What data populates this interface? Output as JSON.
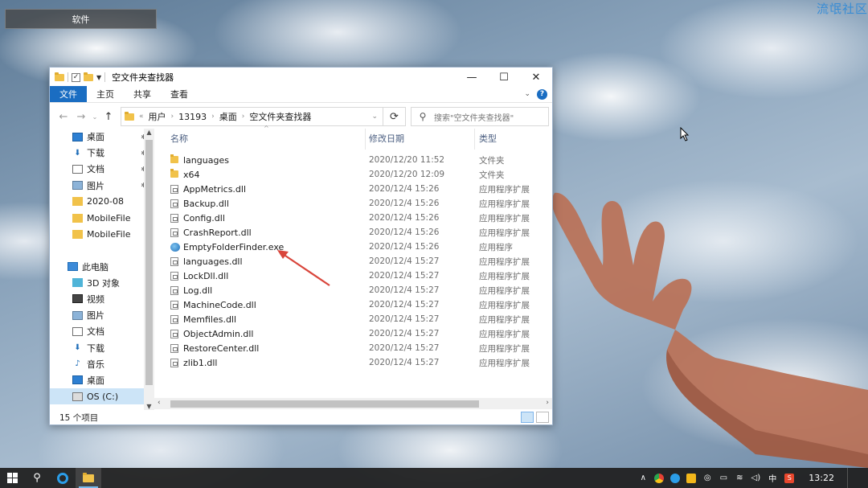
{
  "desktop": {
    "software_label": "软件",
    "watermark": "流氓社区"
  },
  "window": {
    "title": "空文件夹查找器",
    "controls": {
      "minimize": "—",
      "maximize": "☐",
      "close": "✕"
    },
    "ribbon_tabs": [
      "文件",
      "主页",
      "共享",
      "查看"
    ],
    "breadcrumb": [
      "用户",
      "13193",
      "桌面",
      "空文件夹查找器"
    ],
    "search_placeholder": "搜索\"空文件夹查找器\"",
    "columns": {
      "name": "名称",
      "date": "修改日期",
      "type": "类型"
    },
    "nav_items": [
      {
        "label": "桌面",
        "icon": "desktop-icon",
        "pinned": true
      },
      {
        "label": "下载",
        "icon": "download-icon",
        "pinned": true
      },
      {
        "label": "文档",
        "icon": "document-icon",
        "pinned": true
      },
      {
        "label": "图片",
        "icon": "picture-icon",
        "pinned": true
      },
      {
        "label": "2020-08",
        "icon": "folder-icon",
        "pinned": false
      },
      {
        "label": "MobileFile",
        "icon": "folder-icon",
        "pinned": false
      },
      {
        "label": "MobileFile",
        "icon": "folder-icon",
        "pinned": false
      },
      {
        "label": "",
        "icon": "",
        "pinned": false
      },
      {
        "label": "此电脑",
        "icon": "computer-icon",
        "pinned": false
      },
      {
        "label": "3D 对象",
        "icon": "3d-objects-icon",
        "pinned": false
      },
      {
        "label": "视频",
        "icon": "video-icon",
        "pinned": false
      },
      {
        "label": "图片",
        "icon": "picture-icon",
        "pinned": false
      },
      {
        "label": "文档",
        "icon": "document-icon",
        "pinned": false
      },
      {
        "label": "下载",
        "icon": "download-icon",
        "pinned": false
      },
      {
        "label": "音乐",
        "icon": "music-icon",
        "pinned": false
      },
      {
        "label": "桌面",
        "icon": "desktop-icon",
        "pinned": false
      },
      {
        "label": "OS (C:)",
        "icon": "drive-icon",
        "pinned": false
      }
    ],
    "files": [
      {
        "name": "languages",
        "date": "2020/12/20 11:52",
        "type": "文件夹",
        "icon": "folder"
      },
      {
        "name": "x64",
        "date": "2020/12/20 12:09",
        "type": "文件夹",
        "icon": "folder"
      },
      {
        "name": "AppMetrics.dll",
        "date": "2020/12/4 15:26",
        "type": "应用程序扩展",
        "icon": "dll"
      },
      {
        "name": "Backup.dll",
        "date": "2020/12/4 15:26",
        "type": "应用程序扩展",
        "icon": "dll"
      },
      {
        "name": "Config.dll",
        "date": "2020/12/4 15:26",
        "type": "应用程序扩展",
        "icon": "dll"
      },
      {
        "name": "CrashReport.dll",
        "date": "2020/12/4 15:26",
        "type": "应用程序扩展",
        "icon": "dll"
      },
      {
        "name": "EmptyFolderFinder.exe",
        "date": "2020/12/4 15:26",
        "type": "应用程序",
        "icon": "exe"
      },
      {
        "name": "languages.dll",
        "date": "2020/12/4 15:27",
        "type": "应用程序扩展",
        "icon": "dll"
      },
      {
        "name": "LockDll.dll",
        "date": "2020/12/4 15:27",
        "type": "应用程序扩展",
        "icon": "dll"
      },
      {
        "name": "Log.dll",
        "date": "2020/12/4 15:27",
        "type": "应用程序扩展",
        "icon": "dll"
      },
      {
        "name": "MachineCode.dll",
        "date": "2020/12/4 15:27",
        "type": "应用程序扩展",
        "icon": "dll"
      },
      {
        "name": "Memfiles.dll",
        "date": "2020/12/4 15:27",
        "type": "应用程序扩展",
        "icon": "dll"
      },
      {
        "name": "ObjectAdmin.dll",
        "date": "2020/12/4 15:27",
        "type": "应用程序扩展",
        "icon": "dll"
      },
      {
        "name": "RestoreCenter.dll",
        "date": "2020/12/4 15:27",
        "type": "应用程序扩展",
        "icon": "dll"
      },
      {
        "name": "zlib1.dll",
        "date": "2020/12/4 15:27",
        "type": "应用程序扩展",
        "icon": "dll"
      }
    ],
    "status": "15 个项目"
  },
  "taskbar": {
    "ime": "中",
    "time": "13:22"
  },
  "colors": {
    "accent": "#1a6dc2",
    "arrow": "#d9453b",
    "taskbar": "#202020"
  }
}
